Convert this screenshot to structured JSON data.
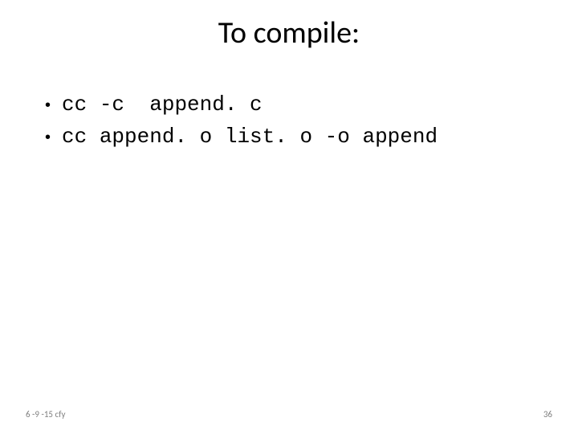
{
  "title": "To compile:",
  "bullets": [
    "cc -c  append. c",
    "cc append. o list. o -o append"
  ],
  "footer": {
    "left": "6 -9 -15 cfy",
    "right": "36"
  }
}
